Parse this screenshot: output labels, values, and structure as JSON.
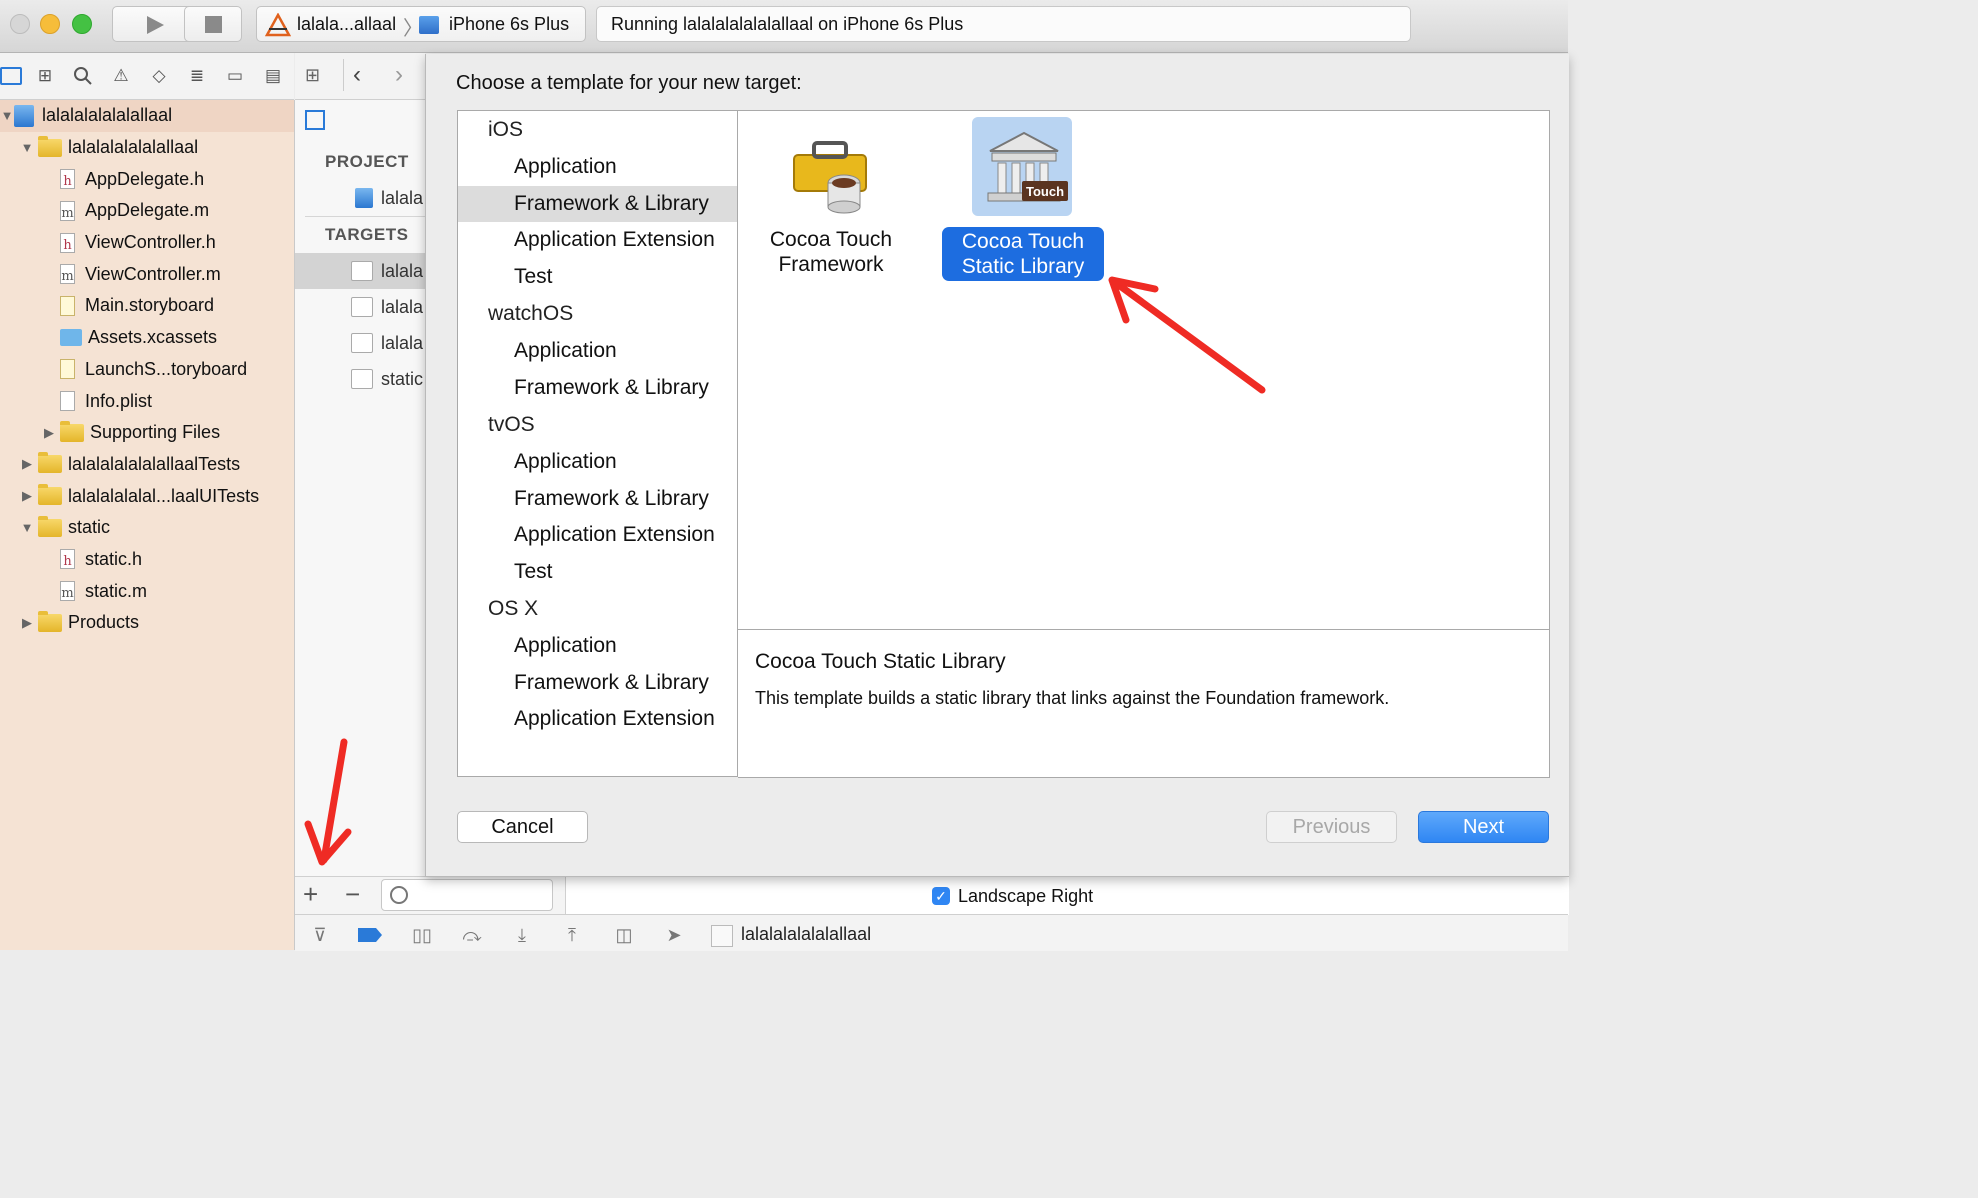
{
  "toolbar": {
    "scheme_target": "lalala...allaal",
    "device": "iPhone 6s Plus",
    "activity_status": "Running lalalalalalalallaal on iPhone 6s Plus"
  },
  "navigator": {
    "items": [
      {
        "label": "lalalalalalalallaal",
        "kind": "project",
        "indent": 0,
        "expanded": true,
        "selected": true
      },
      {
        "label": "lalalalalalalallaal",
        "kind": "folder",
        "indent": 1,
        "expanded": true
      },
      {
        "label": "AppDelegate.h",
        "kind": "h",
        "indent": 2
      },
      {
        "label": "AppDelegate.m",
        "kind": "m",
        "indent": 2
      },
      {
        "label": "ViewController.h",
        "kind": "h",
        "indent": 2
      },
      {
        "label": "ViewController.m",
        "kind": "m",
        "indent": 2
      },
      {
        "label": "Main.storyboard",
        "kind": "storyboard",
        "indent": 2
      },
      {
        "label": "Assets.xcassets",
        "kind": "assets",
        "indent": 2
      },
      {
        "label": "LaunchS...toryboard",
        "kind": "storyboard",
        "indent": 2
      },
      {
        "label": "Info.plist",
        "kind": "plist",
        "indent": 2
      },
      {
        "label": "Supporting Files",
        "kind": "folder",
        "indent": 2,
        "expanded": false
      },
      {
        "label": "lalalalalalalallaalTests",
        "kind": "folder",
        "indent": 1,
        "expanded": false
      },
      {
        "label": "lalalalalalal...laalUITests",
        "kind": "folder",
        "indent": 1,
        "expanded": false
      },
      {
        "label": "static",
        "kind": "folder",
        "indent": 1,
        "expanded": true
      },
      {
        "label": "static.h",
        "kind": "h",
        "indent": 2
      },
      {
        "label": "static.m",
        "kind": "m",
        "indent": 2
      },
      {
        "label": "Products",
        "kind": "folder",
        "indent": 1,
        "expanded": false
      }
    ]
  },
  "editor": {
    "project_header": "PROJECT",
    "project_item": "lalala",
    "targets_header": "TARGETS",
    "targets": [
      "lalala",
      "lalala",
      "lalala",
      "static"
    ]
  },
  "sheet": {
    "title": "Choose a template for your new target:",
    "categories": [
      {
        "platform": "iOS",
        "items": [
          "Application",
          "Framework & Library",
          "Application Extension",
          "Test"
        ]
      },
      {
        "platform": "watchOS",
        "items": [
          "Application",
          "Framework & Library"
        ]
      },
      {
        "platform": "tvOS",
        "items": [
          "Application",
          "Framework & Library",
          "Application Extension",
          "Test"
        ]
      },
      {
        "platform": "OS X",
        "items": [
          "Application",
          "Framework & Library",
          "Application Extension"
        ]
      }
    ],
    "selected_category": "iOS / Framework & Library",
    "templates": {
      "framework": {
        "line1": "Cocoa Touch",
        "line2": "Framework"
      },
      "static_lib": {
        "line1": "Cocoa Touch",
        "line2": "Static Library",
        "badge": "Touch"
      }
    },
    "description": {
      "title": "Cocoa Touch Static Library",
      "body": "This template builds a static library that links against the Foundation framework."
    },
    "buttons": {
      "cancel": "Cancel",
      "previous": "Previous",
      "next": "Next"
    }
  },
  "bottom": {
    "orientation_label": "Landscape Right",
    "orientation_checked": true,
    "debug_target": "lalalalalalalallaal"
  },
  "colors": {
    "navigator_bg": "#f5e3d4",
    "selection_blue": "#1d6de0",
    "annotation_arrow": "#ef2b24"
  }
}
